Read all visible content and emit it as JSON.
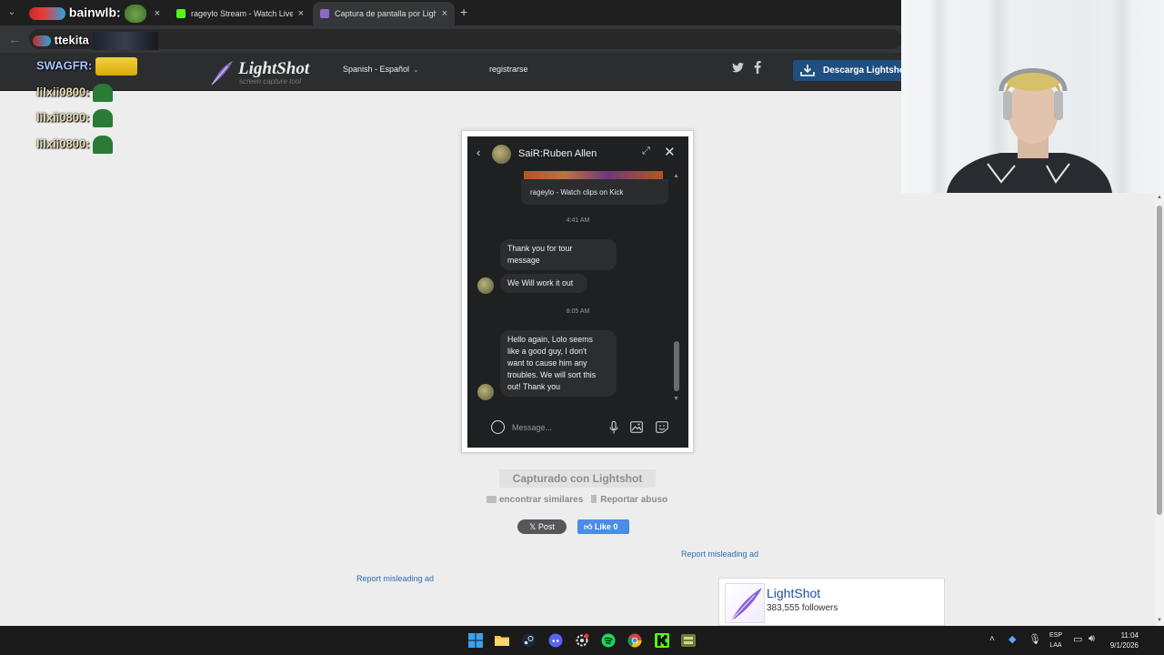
{
  "browser": {
    "tabs": [
      {
        "label": "",
        "active": false
      },
      {
        "label": "rageylo Stream - Watch Live on",
        "active": false
      },
      {
        "label": "Captura de pantalla por Lightsh",
        "active": true
      }
    ],
    "close_glyph": "×",
    "new_tab_glyph": "+"
  },
  "overlay_chat": {
    "line1": {
      "user": "bainwlb:"
    },
    "line2": {
      "user": "ttekita"
    },
    "line3": {
      "user": "SWAGFR:"
    },
    "line4": {
      "user": "lilxii0800:"
    },
    "line5": {
      "user": "lilxii0800:"
    },
    "line6": {
      "user": "lilxii0800:"
    }
  },
  "header": {
    "logo_name": "LightShot",
    "logo_tagline": "screen capture tool",
    "language": "Spanish - Español",
    "register": "registrarse",
    "download": "Descarga Lightshot"
  },
  "chat_window": {
    "contact_name": "SaiR:Ruben Allen",
    "clip_caption": "rageylo - Watch clips on Kick",
    "time1": "4:41 AM",
    "msg1_line1": "Thank you for tour",
    "msg1_line2": "message",
    "msg2": "We Will work it out",
    "time2": "8:05 AM",
    "msg3_lines": [
      "Hello again, Lolo seems",
      "like a good guy, I don't",
      "want to cause him any",
      "troubles. We will sort this",
      "out! Thank you"
    ],
    "composer_placeholder": "Message..."
  },
  "page": {
    "captured_label": "Capturado con Lightshot",
    "find_similar": "encontrar similares",
    "report_abuse": "Reportar abuso",
    "x_post": "Post",
    "fb_like": "Like 0",
    "report_ad_1": "Report misleading ad",
    "report_ad_2": "Report misleading ad",
    "fb_page_name": "LightShot",
    "fb_followers": "383,555 followers"
  },
  "taskbar": {
    "lang_top": "ESP",
    "lang_bottom": "LAA",
    "time": "11:04",
    "date": "9/1/2026"
  },
  "colors": {
    "accent_blue": "#1e4f80",
    "link_blue": "#2a6fb0",
    "fb_blue": "#4a8ce7"
  }
}
